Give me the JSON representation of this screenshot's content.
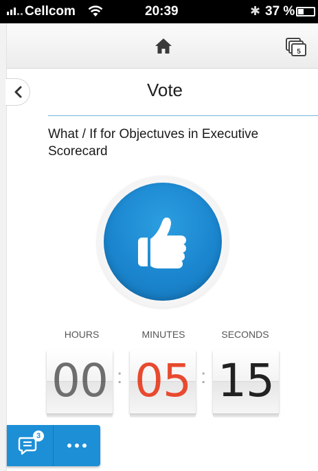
{
  "status_bar": {
    "carrier": "Cellcom",
    "time": "20:39",
    "battery_percent": "37 %",
    "icons": [
      "signal-icon",
      "wifi-icon",
      "bluetooth-icon",
      "battery-icon"
    ]
  },
  "nav": {
    "icons": [
      "home-icon",
      "cards-icon"
    ],
    "cards_count": "5"
  },
  "page": {
    "title": "Vote",
    "question": "What / If for Objectuves in Executive Scorecard"
  },
  "vote": {
    "icon": "thumbs-up-icon",
    "accent_color": "#1b86cf"
  },
  "timer": {
    "hours_label": "HOURS",
    "minutes_label": "MINUTES",
    "seconds_label": "SECONDS",
    "hours": "00",
    "minutes": "05",
    "seconds": "15",
    "separator": ":",
    "hours_color": "#6e6e6e",
    "minutes_color": "#e84a2f",
    "seconds_color": "#222222"
  },
  "toolbar": {
    "chat_badge": "3",
    "icons": [
      "chat-icon",
      "more-icon"
    ],
    "color": "#1d8fd6"
  }
}
